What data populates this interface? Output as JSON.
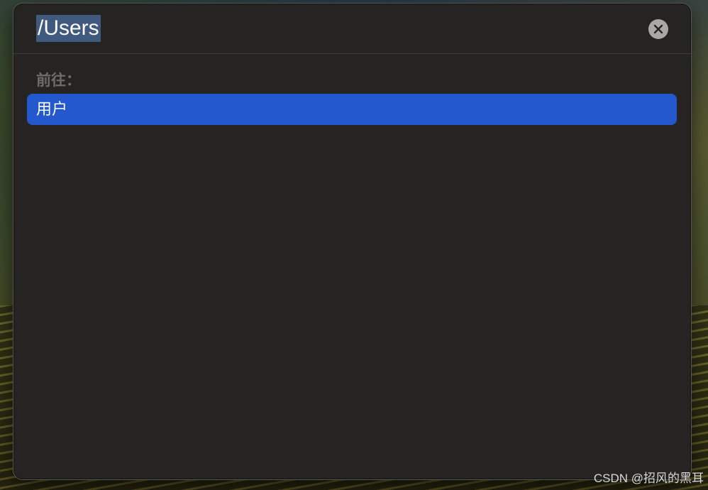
{
  "dialog": {
    "path_value": "/Users",
    "close_icon": "close-icon",
    "section_label": "前往：",
    "results": [
      {
        "label": "用户"
      }
    ],
    "accent_color": "#2458cf"
  },
  "watermark": "CSDN @招风的黑耳"
}
